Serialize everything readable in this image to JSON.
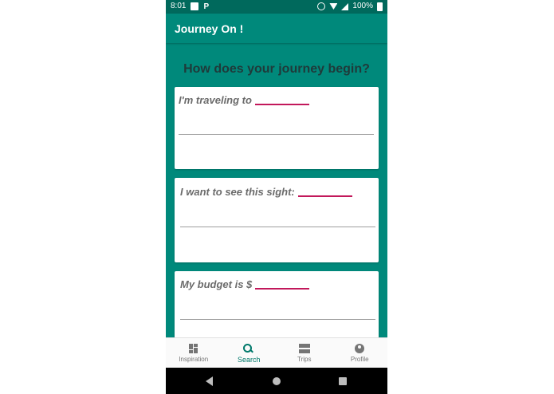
{
  "status_bar": {
    "time": "8:01",
    "battery": "100%",
    "icons": [
      "photo-icon",
      "p-icon",
      "alarm-icon",
      "wifi-icon",
      "signal-icon",
      "battery-icon"
    ]
  },
  "app_bar": {
    "title": "Journey On !"
  },
  "main": {
    "question": "How does your journey begin?",
    "cards": [
      {
        "label": "I'm traveling to"
      },
      {
        "label": "I want to see this sight:"
      },
      {
        "label": "My budget is $"
      }
    ]
  },
  "bottom_nav": {
    "items": [
      {
        "label": "Inspiration",
        "icon": "dashboard-icon"
      },
      {
        "label": "Search",
        "icon": "search-icon",
        "active": true
      },
      {
        "label": "Trips",
        "icon": "trips-icon"
      },
      {
        "label": "Profile",
        "icon": "profile-icon"
      }
    ]
  },
  "colors": {
    "primary": "#00897b",
    "primary_dark": "#00695c",
    "accent": "#c2185b",
    "active_nav": "#00796b"
  }
}
